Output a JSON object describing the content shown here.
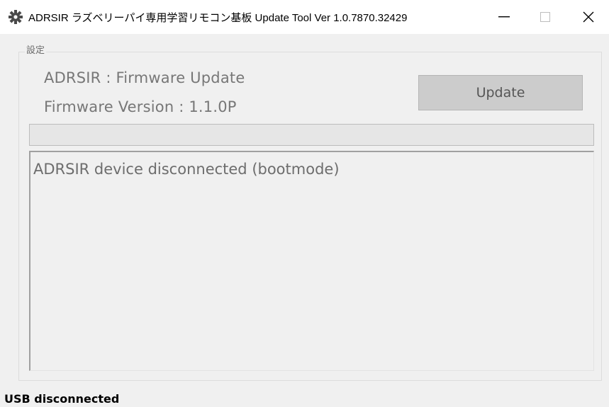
{
  "window": {
    "title": "ADRSIR ラズベリーパイ専用学習リモコン基板 Update Tool Ver 1.0.7870.32429",
    "app_icon": "gear-icon",
    "controls": {
      "minimize_icon": "minimize-icon",
      "maximize_icon": "maximize-icon",
      "close_icon": "close-icon"
    }
  },
  "settings_group": {
    "legend": "設定",
    "device_line": "ADRSIR : Firmware Update",
    "version_line": "Firmware Version : 1.1.0P",
    "update_button_label": "Update",
    "update_button_enabled": false
  },
  "progress": {
    "value_percent": 0
  },
  "log": {
    "text": "ADRSIR device disconnected (bootmode)"
  },
  "status_bar": {
    "text": "USB disconnected"
  },
  "colors": {
    "window_bg": "#f0f0f0",
    "titlebar_bg": "#ffffff",
    "disabled_text": "#777777",
    "button_bg": "#cccccc",
    "progress_fill": "#06b025"
  }
}
